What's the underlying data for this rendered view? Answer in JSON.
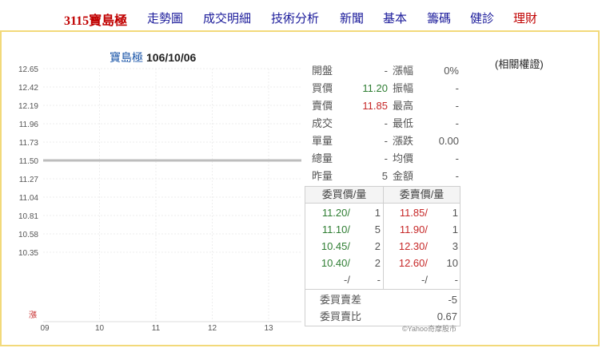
{
  "nav": {
    "brand": "3115寶島極",
    "items": [
      "走勢圖",
      "成交明細",
      "技術分析",
      "新聞",
      "基本",
      "籌碼",
      "健診"
    ],
    "last": "理財"
  },
  "chart": {
    "name": "寶島極",
    "date": "106/10/06",
    "related": "(相關權證)",
    "limit_label": "漲",
    "copyright": "©Yahoo奇摩股市"
  },
  "chart_data": {
    "type": "line",
    "y_ticks": [
      "12.65",
      "12.42",
      "12.19",
      "11.96",
      "11.73",
      "11.50",
      "11.27",
      "11.04",
      "10.81",
      "10.58",
      "10.35"
    ],
    "x_ticks": [
      "09",
      "10",
      "11",
      "12",
      "13"
    ],
    "ylim": [
      10.35,
      12.65
    ],
    "reference_line": 11.5,
    "series": [],
    "grid": true
  },
  "quote": {
    "left": [
      {
        "label": "開盤",
        "value": "-",
        "color": "gray"
      },
      {
        "label": "買價",
        "value": "11.20",
        "color": "green"
      },
      {
        "label": "賣價",
        "value": "11.85",
        "color": "red"
      },
      {
        "label": "成交",
        "value": "-",
        "color": "gray"
      },
      {
        "label": "單量",
        "value": "-",
        "color": "gray"
      },
      {
        "label": "總量",
        "value": "-",
        "color": "gray"
      },
      {
        "label": "昨量",
        "value": "5",
        "color": "gray"
      }
    ],
    "right": [
      {
        "label": "漲幅",
        "value": "0%",
        "color": "gray"
      },
      {
        "label": "振幅",
        "value": "-",
        "color": "gray"
      },
      {
        "label": "最高",
        "value": "-",
        "color": "gray"
      },
      {
        "label": "最低",
        "value": "-",
        "color": "gray"
      },
      {
        "label": "漲跌",
        "value": "0.00",
        "color": "gray"
      },
      {
        "label": "均價",
        "value": "-",
        "color": "gray"
      },
      {
        "label": "金額",
        "value": "-",
        "color": "gray"
      }
    ]
  },
  "book": {
    "buy_header": "委買價/量",
    "sell_header": "委賣價/量",
    "rows": [
      {
        "bp": "11.20/",
        "bv": "1",
        "sp": "11.85/",
        "sv": "1"
      },
      {
        "bp": "11.10/",
        "bv": "5",
        "sp": "11.90/",
        "sv": "1"
      },
      {
        "bp": "10.45/",
        "bv": "2",
        "sp": "12.30/",
        "sv": "3"
      },
      {
        "bp": "10.40/",
        "bv": "2",
        "sp": "12.60/",
        "sv": "10"
      },
      {
        "bp": "-/",
        "bv": "-",
        "sp": "-/",
        "sv": "-"
      }
    ],
    "diff_label": "委買賣差",
    "diff_value": "-5",
    "ratio_label": "委買賣比",
    "ratio_value": "0.67"
  }
}
